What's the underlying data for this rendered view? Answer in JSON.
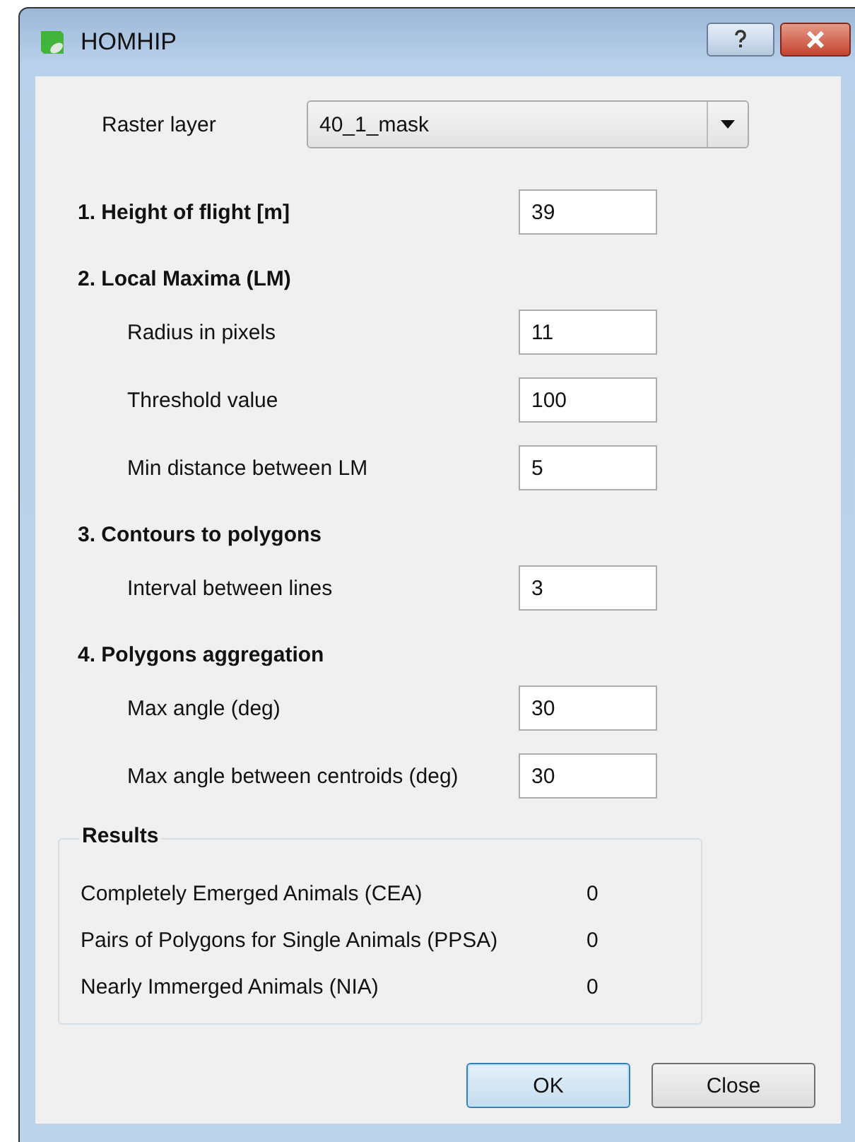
{
  "window": {
    "title": "HOMHIP"
  },
  "raster_layer": {
    "label": "Raster layer",
    "value": "40_1_mask"
  },
  "sections": [
    {
      "title": "1. Height of flight [m]",
      "value": "39"
    },
    {
      "title": "2. Local Maxima (LM)",
      "params": [
        {
          "label": "Radius in pixels",
          "value": "11"
        },
        {
          "label": "Threshold value",
          "value": "100"
        },
        {
          "label": "Min distance between LM",
          "value": "5"
        }
      ]
    },
    {
      "title": "3. Contours to polygons",
      "params": [
        {
          "label": "Interval between lines",
          "value": "3"
        }
      ]
    },
    {
      "title": "4. Polygons aggregation",
      "params": [
        {
          "label": "Max angle (deg)",
          "value": "30"
        },
        {
          "label": "Max angle between centroids (deg)",
          "value": "30"
        }
      ]
    }
  ],
  "results": {
    "title": "Results",
    "rows": [
      {
        "label": "Completely Emerged Animals (CEA)",
        "value": "0"
      },
      {
        "label": "Pairs of Polygons for Single Animals (PPSA)",
        "value": "0"
      },
      {
        "label": "Nearly Immerged Animals (NIA)",
        "value": "0"
      }
    ]
  },
  "buttons": [
    {
      "label": "OK",
      "default": true
    },
    {
      "label": "Close",
      "default": false
    }
  ]
}
